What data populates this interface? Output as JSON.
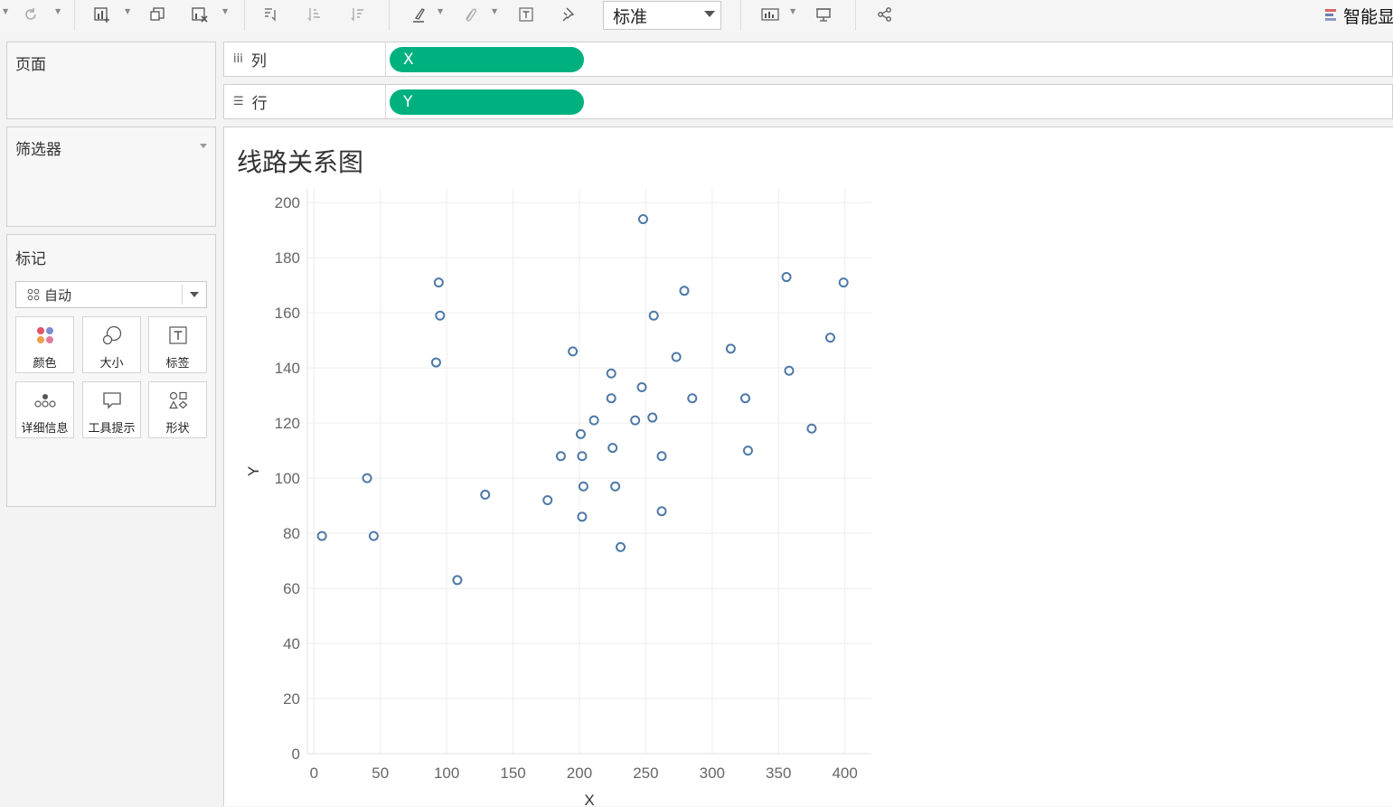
{
  "toolbar": {
    "marks_type": "标准",
    "smart_label": "智能显",
    "icons": [
      "redo-icon",
      "new-worksheet-icon",
      "duplicate-icon",
      "clear-icon",
      "swap-icon",
      "sort-ascending-icon",
      "sort-descending-icon",
      "highlight-icon",
      "group-icon",
      "label-icon",
      "pin-icon",
      "show-me-icon",
      "presentation-icon",
      "share-icon"
    ]
  },
  "panels": {
    "pages": {
      "title": "页面"
    },
    "filters": {
      "title": "筛选器"
    },
    "marks": {
      "title": "标记",
      "mark_type": "自动",
      "buttons": [
        {
          "label": "颜色",
          "icon": "color-dots-icon"
        },
        {
          "label": "大小",
          "icon": "size-icon"
        },
        {
          "label": "标签",
          "icon": "label-t-icon"
        },
        {
          "label": "详细信息",
          "icon": "detail-dots-icon"
        },
        {
          "label": "工具提示",
          "icon": "tooltip-icon"
        },
        {
          "label": "形状",
          "icon": "shape-icon"
        }
      ]
    }
  },
  "shelves": {
    "columns": {
      "label": "列",
      "pill": "X"
    },
    "rows": {
      "label": "行",
      "pill": "Y"
    }
  },
  "colors": {
    "pill": "#00b180",
    "point": "#4e79a7"
  },
  "chart_data": {
    "type": "scatter",
    "title": "线路关系图",
    "xlabel": "X",
    "ylabel": "Y",
    "xlim": [
      -5,
      420
    ],
    "ylim": [
      0,
      205
    ],
    "xticks": [
      0,
      50,
      100,
      150,
      200,
      250,
      300,
      350,
      400
    ],
    "yticks": [
      0,
      20,
      40,
      60,
      80,
      100,
      120,
      140,
      160,
      180,
      200
    ],
    "grid": true,
    "marker": "hollow-circle",
    "x": [
      6,
      40,
      45,
      92,
      94,
      95,
      108,
      129,
      176,
      186,
      195,
      201,
      202,
      202,
      203,
      211,
      224,
      224,
      225,
      227,
      231,
      242,
      247,
      248,
      255,
      256,
      262,
      262,
      273,
      279,
      285,
      314,
      325,
      327,
      356,
      358,
      375,
      389,
      399
    ],
    "y": [
      79,
      100,
      79,
      142,
      171,
      159,
      63,
      94,
      92,
      108,
      146,
      116,
      108,
      86,
      97,
      121,
      138,
      129,
      111,
      97,
      75,
      121,
      133,
      194,
      122,
      159,
      108,
      88,
      144,
      168,
      129,
      147,
      129,
      110,
      173,
      139,
      118,
      151,
      171
    ]
  }
}
